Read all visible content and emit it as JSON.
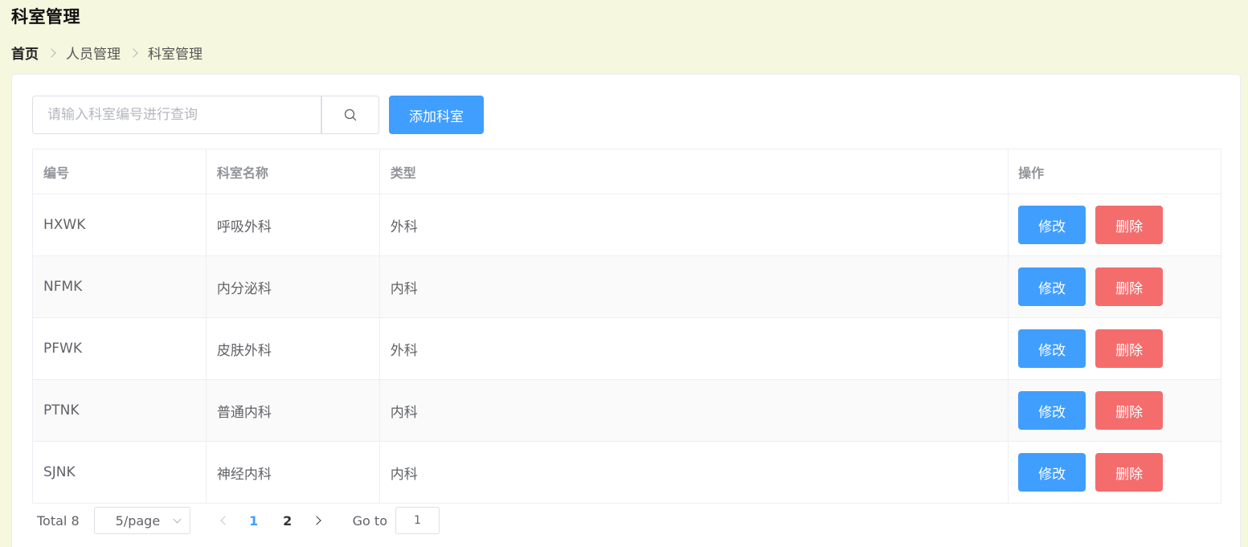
{
  "page": {
    "title": "科室管理"
  },
  "breadcrumb": [
    "首页",
    "人员管理",
    "科室管理"
  ],
  "toolbar": {
    "search_placeholder": "请输入科室编号进行查询",
    "search_icon": "search-icon",
    "add_label": "添加科室"
  },
  "table": {
    "headers": [
      "编号",
      "科室名称",
      "类型",
      "操作"
    ],
    "rows": [
      {
        "id": "HXWK",
        "name": "呼吸外科",
        "type": "外科"
      },
      {
        "id": "NFMK",
        "name": "内分泌科",
        "type": "内科"
      },
      {
        "id": "PFWK",
        "name": "皮肤外科",
        "type": "外科"
      },
      {
        "id": "PTNK",
        "name": "普通内科",
        "type": "内科"
      },
      {
        "id": "SJNK",
        "name": "神经内科",
        "type": "内科"
      }
    ],
    "edit_label": "修改",
    "delete_label": "删除"
  },
  "pagination": {
    "total_label": "Total 8",
    "page_size": "5/page",
    "pages": [
      "1",
      "2"
    ],
    "current_page": "1",
    "goto_label": "Go to",
    "goto_value": "1"
  },
  "colors": {
    "background": "#f5f7df",
    "primary": "#409eff",
    "danger": "#f56c6c"
  }
}
